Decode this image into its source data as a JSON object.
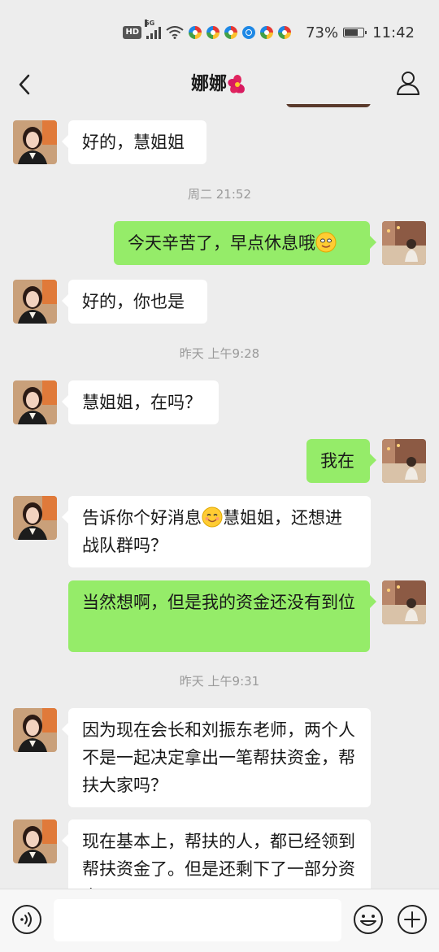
{
  "status_bar": {
    "hd": "HD",
    "network": "5G",
    "battery": "73%",
    "battery_level": 0.73,
    "time": "11:42",
    "icons": [
      "hd-icon",
      "signal-icon",
      "wifi-icon",
      "app-notification-icon",
      "app-notification-icon",
      "app-notification-icon",
      "app-notification-icon",
      "app-notification-icon",
      "app-notification-icon",
      "battery-icon"
    ]
  },
  "header": {
    "title": "娜娜",
    "title_emoji": "hibiscus-icon",
    "back_icon": "chevron-left-icon",
    "profile_icon": "person-icon"
  },
  "messages": [
    {
      "side": "left",
      "text": "好的，慧姐姐"
    },
    {
      "side": "time",
      "text": "周二 21:52"
    },
    {
      "side": "right",
      "text": "今天辛苦了，早点休息哦",
      "emoji": "smile-icon"
    },
    {
      "side": "left",
      "text": "好的，你也是"
    },
    {
      "side": "time",
      "text": "昨天 上午9:28"
    },
    {
      "side": "left",
      "text": "慧姐姐，在吗？"
    },
    {
      "side": "right",
      "text": "我在"
    },
    {
      "side": "left",
      "text_before": "告诉你个好消息",
      "emoji": "smile-icon",
      "text_after": "慧姐姐，还想进战队群吗？"
    },
    {
      "side": "right",
      "text": "当然想啊，但是我的资金还没有到位"
    },
    {
      "side": "time",
      "text": "昨天 上午9:31"
    },
    {
      "side": "left",
      "text": "因为现在会长和刘振东老师，两个人不是一起决定拿出一笔帮扶资金，帮扶大家吗？"
    },
    {
      "side": "left",
      "text": "现在基本上，帮扶的人，都已经领到帮扶资金了。但是还剩下了一部分资金"
    }
  ],
  "input_bar": {
    "voice_icon": "voice-icon",
    "emoji_icon": "emoji-icon",
    "plus_icon": "plus-icon",
    "value": "",
    "placeholder": ""
  },
  "colors": {
    "background": "#ededed",
    "bubble_self": "#95ec69",
    "bubble_other": "#ffffff",
    "timestamp": "#9a9a9a"
  }
}
